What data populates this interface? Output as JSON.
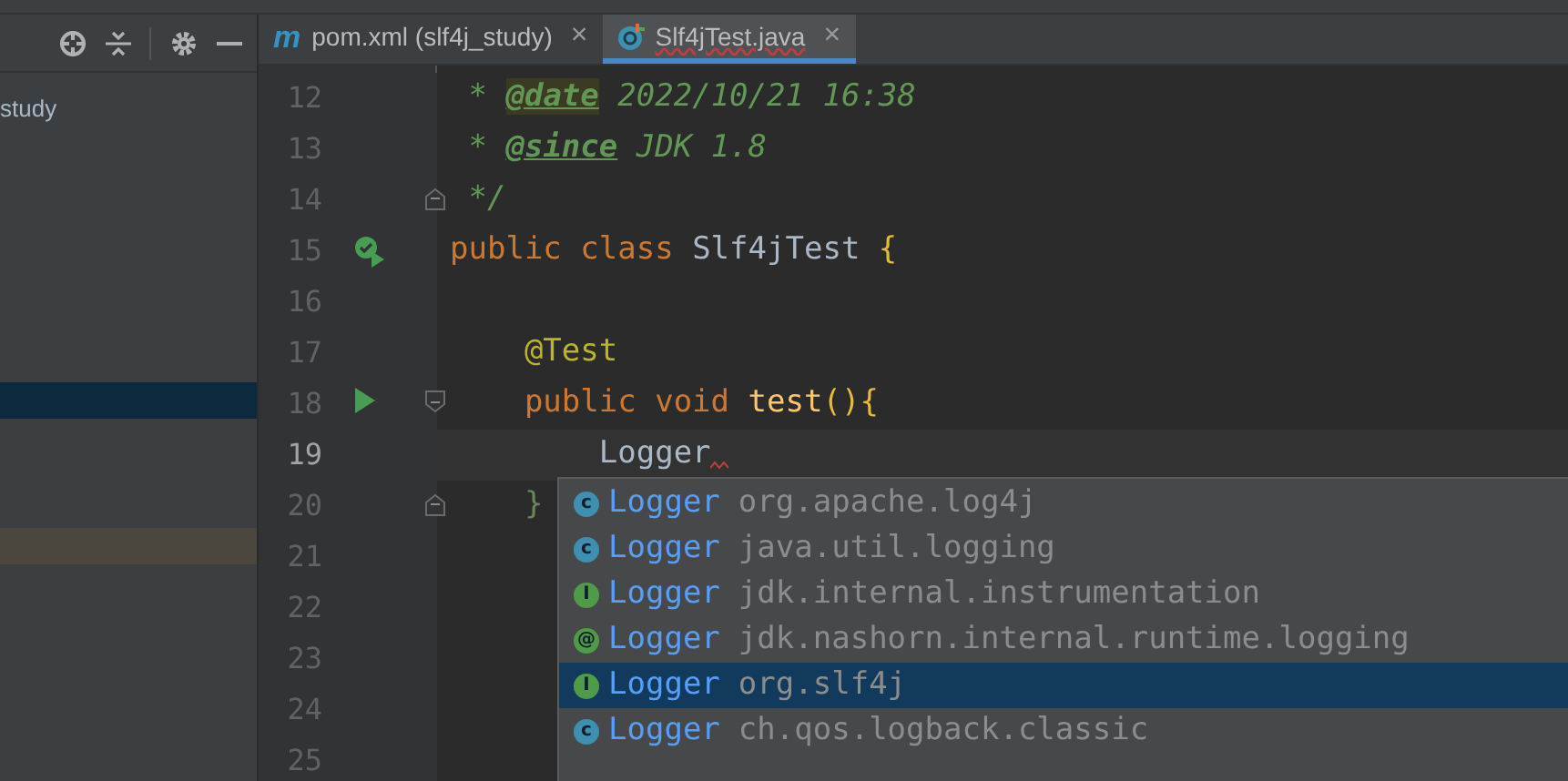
{
  "project_panel": {
    "items": [
      {
        "label": "study",
        "selected": false,
        "highlighted": false
      },
      {
        "selected": true,
        "highlighted": false
      },
      {
        "selected": false,
        "highlighted": true
      }
    ]
  },
  "tabs": [
    {
      "kind": "maven",
      "icon_text": "m",
      "label": "pom.xml (slf4j_study)",
      "close": "×",
      "selected": false
    },
    {
      "kind": "class",
      "label": "Slf4jTest.java",
      "close": "×",
      "selected": true
    }
  ],
  "code": {
    "lines": [
      {
        "number": "12",
        "current": false,
        "tokens": [
          {
            "kind": "comment",
            "text": " * "
          },
          {
            "kind": "doctag_hl",
            "text": "@date"
          },
          {
            "kind": "comment",
            "text": " 2022/10/21 16:38"
          }
        ]
      },
      {
        "number": "13",
        "current": false,
        "tokens": [
          {
            "kind": "comment",
            "text": " * "
          },
          {
            "kind": "doctag",
            "text": "@since"
          },
          {
            "kind": "comment",
            "text": " JDK 1.8"
          }
        ]
      },
      {
        "number": "14",
        "current": false,
        "fold_end": true,
        "tokens": [
          {
            "kind": "comment",
            "text": " */"
          }
        ]
      },
      {
        "number": "15",
        "current": false,
        "run_test_button": true,
        "tokens": [
          {
            "kind": "keyword",
            "text": "public class "
          },
          {
            "kind": "plain",
            "text": "Slf4jTest "
          },
          {
            "kind": "brace",
            "text": "{"
          }
        ]
      },
      {
        "number": "16",
        "current": false
      },
      {
        "number": "17",
        "current": false,
        "tokens": [
          {
            "kind": "annotation",
            "text": "    @Test"
          }
        ]
      },
      {
        "number": "18",
        "current": false,
        "run_button": true,
        "fold_start": true,
        "tokens": [
          {
            "kind": "keyword",
            "text": "    public void "
          },
          {
            "kind": "method",
            "text": "test"
          },
          {
            "kind": "brace",
            "text": "(){"
          }
        ]
      },
      {
        "number": "19",
        "current": true,
        "error_mark": true,
        "tokens": [
          {
            "kind": "plain",
            "text": "        Logger"
          }
        ]
      },
      {
        "number": "20",
        "current": false,
        "fold_end": true,
        "tokens": [
          {
            "kind": "brace_match",
            "text": "    }"
          }
        ]
      },
      {
        "number": "21",
        "current": false
      },
      {
        "number": "22",
        "current": false
      },
      {
        "number": "23",
        "current": false
      },
      {
        "number": "24",
        "current": false
      },
      {
        "number": "25",
        "current": false
      }
    ]
  },
  "completion": {
    "items": [
      {
        "kind": "class",
        "icon_text": "c",
        "name": "Logger",
        "package": "org.apache.log4j",
        "selected": false
      },
      {
        "kind": "class",
        "icon_text": "c",
        "name": "Logger",
        "package": "java.util.logging",
        "selected": false
      },
      {
        "kind": "interface",
        "icon_text": "I",
        "name": "Logger",
        "package": "jdk.internal.instrumentation",
        "selected": false
      },
      {
        "kind": "annotation",
        "icon_text": "@",
        "name": "Logger",
        "package": "jdk.nashorn.internal.runtime.logging",
        "selected": false
      },
      {
        "kind": "interface",
        "icon_text": "I",
        "name": "Logger",
        "package": "org.slf4j",
        "selected": true
      },
      {
        "kind": "class",
        "icon_text": "c",
        "name": "Logger",
        "package": "ch.qos.logback.classic",
        "selected": false
      }
    ]
  }
}
